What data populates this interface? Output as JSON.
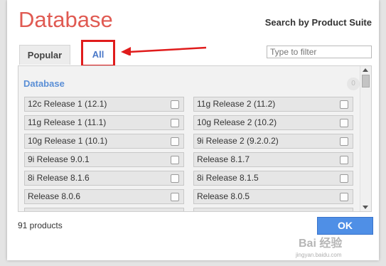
{
  "dialog": {
    "title": "Database",
    "subtitle": "Search by Product Suite"
  },
  "tabs": [
    {
      "label": "Popular",
      "selected": false
    },
    {
      "label": "All",
      "selected": true
    }
  ],
  "filter": {
    "placeholder": "Type to filter",
    "value": ""
  },
  "section": {
    "label": "Database",
    "count": "0"
  },
  "items": [
    {
      "label": "12c Release 1 (12.1)",
      "checked": false
    },
    {
      "label": "11g Release 2 (11.2)",
      "checked": false
    },
    {
      "label": "11g Release 1 (11.1)",
      "checked": false
    },
    {
      "label": "10g Release 2 (10.2)",
      "checked": false
    },
    {
      "label": "10g Release 1 (10.1)",
      "checked": false
    },
    {
      "label": "9i Release 2 (9.2.0.2)",
      "checked": false
    },
    {
      "label": "9i Release 9.0.1",
      "checked": false
    },
    {
      "label": "Release 8.1.7",
      "checked": false
    },
    {
      "label": "8i Release 8.1.6",
      "checked": false
    },
    {
      "label": "8i Release 8.1.5",
      "checked": false
    },
    {
      "label": "Release 8.0.6",
      "checked": false
    },
    {
      "label": "Release 8.0.5",
      "checked": false
    }
  ],
  "footer": {
    "product_count": "91 products",
    "ok_label": "OK"
  },
  "watermark": {
    "text": "Bai 经验",
    "sub": "jingyan.baidu.com"
  },
  "colors": {
    "title": "#e05a52",
    "accent": "#4f8fe6",
    "highlight": "#e01c1c"
  }
}
